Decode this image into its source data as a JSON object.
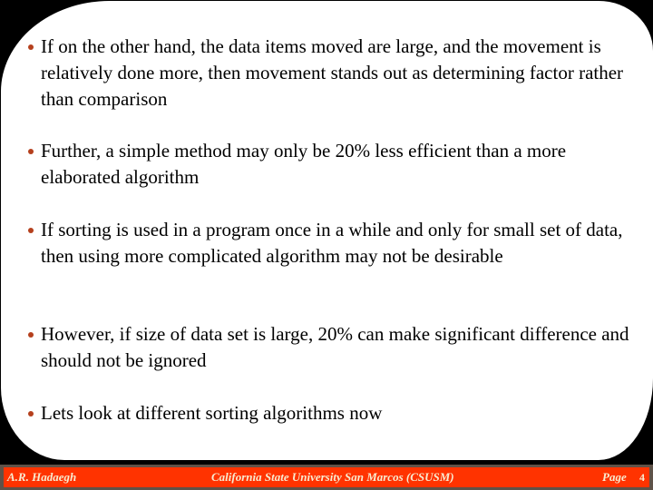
{
  "slide": {
    "bullets": [
      {
        "text": "If on the other hand, the data items moved are large, and the movement is relatively done more, then movement stands out as determining factor rather than comparison"
      },
      {
        "text": "Further, a simple method may only be 20% less efficient than a more elaborated algorithm"
      },
      {
        "text": "If sorting is used in a  program once in a while and only for small set of data, then using more complicated algorithm may not be desirable"
      },
      {
        "text": "However,  if size of data set is large, 20% can make significant difference and should not be ignored"
      },
      {
        "text": "Lets look at different sorting algorithms now"
      }
    ],
    "bullet_color": "#b5401d"
  },
  "footer": {
    "author": "A.R. Hadaegh",
    "institution": "California State University San Marcos (CSUSM)",
    "page_label": "Page",
    "page_number": "4",
    "bar_color": "#ff3300",
    "band_color": "#5f5248"
  }
}
